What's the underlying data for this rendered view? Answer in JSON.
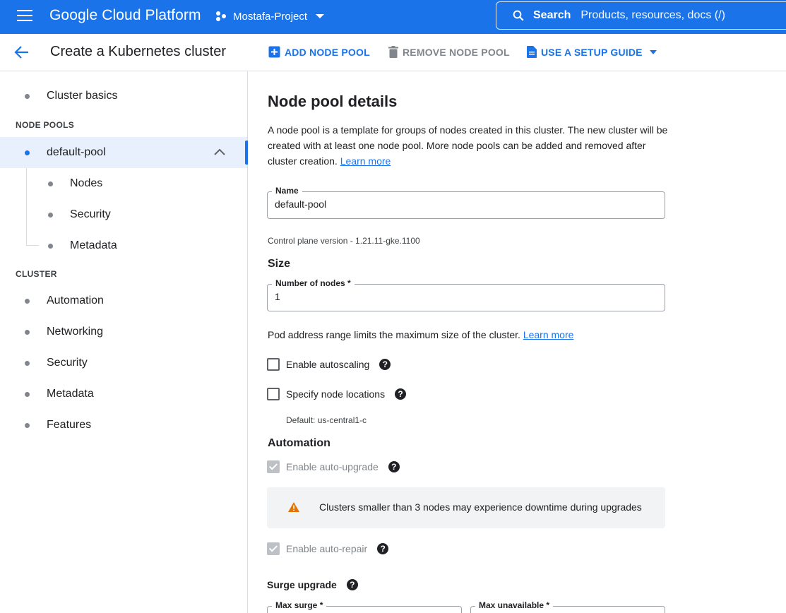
{
  "topbar": {
    "brand": "Google Cloud Platform",
    "project": "Mostafa-Project",
    "search_label": "Search",
    "search_placeholder": "Products, resources, docs (/)"
  },
  "header": {
    "title": "Create a Kubernetes cluster",
    "add_node_pool": "ADD NODE POOL",
    "remove_node_pool": "REMOVE NODE POOL",
    "setup_guide": "USE A SETUP GUIDE"
  },
  "sidebar": {
    "cluster_basics": "Cluster basics",
    "node_pools_label": "NODE POOLS",
    "default_pool": "default-pool",
    "pool_children": [
      "Nodes",
      "Security",
      "Metadata"
    ],
    "cluster_label": "CLUSTER",
    "cluster_items": [
      "Automation",
      "Networking",
      "Security",
      "Metadata",
      "Features"
    ]
  },
  "main": {
    "title": "Node pool details",
    "description": "A node pool is a template for groups of nodes created in this cluster. The new cluster will be created with at least one node pool. More node pools can be added and removed after cluster creation.",
    "learn_more": "Learn more",
    "name_label": "Name",
    "name_value": "default-pool",
    "control_plane": "Control plane version - 1.21.11-gke.1100",
    "size_heading": "Size",
    "nodes_label": "Number of nodes *",
    "nodes_value": "1",
    "pod_range": "Pod address range limits the maximum size of the cluster.",
    "pod_learn_more": "Learn more",
    "enable_autoscaling": "Enable autoscaling",
    "specify_locations": "Specify node locations",
    "default_location": "Default: us-central1-c",
    "automation_heading": "Automation",
    "auto_upgrade": "Enable auto-upgrade",
    "warning": "Clusters smaller than 3 nodes may experience downtime during upgrades",
    "auto_repair": "Enable auto-repair",
    "surge_heading": "Surge upgrade",
    "max_surge_label": "Max surge *",
    "max_unavailable_label": "Max unavailable *"
  },
  "colors": {
    "brand_blue": "#1a73e8",
    "warning_orange": "#e37400"
  }
}
